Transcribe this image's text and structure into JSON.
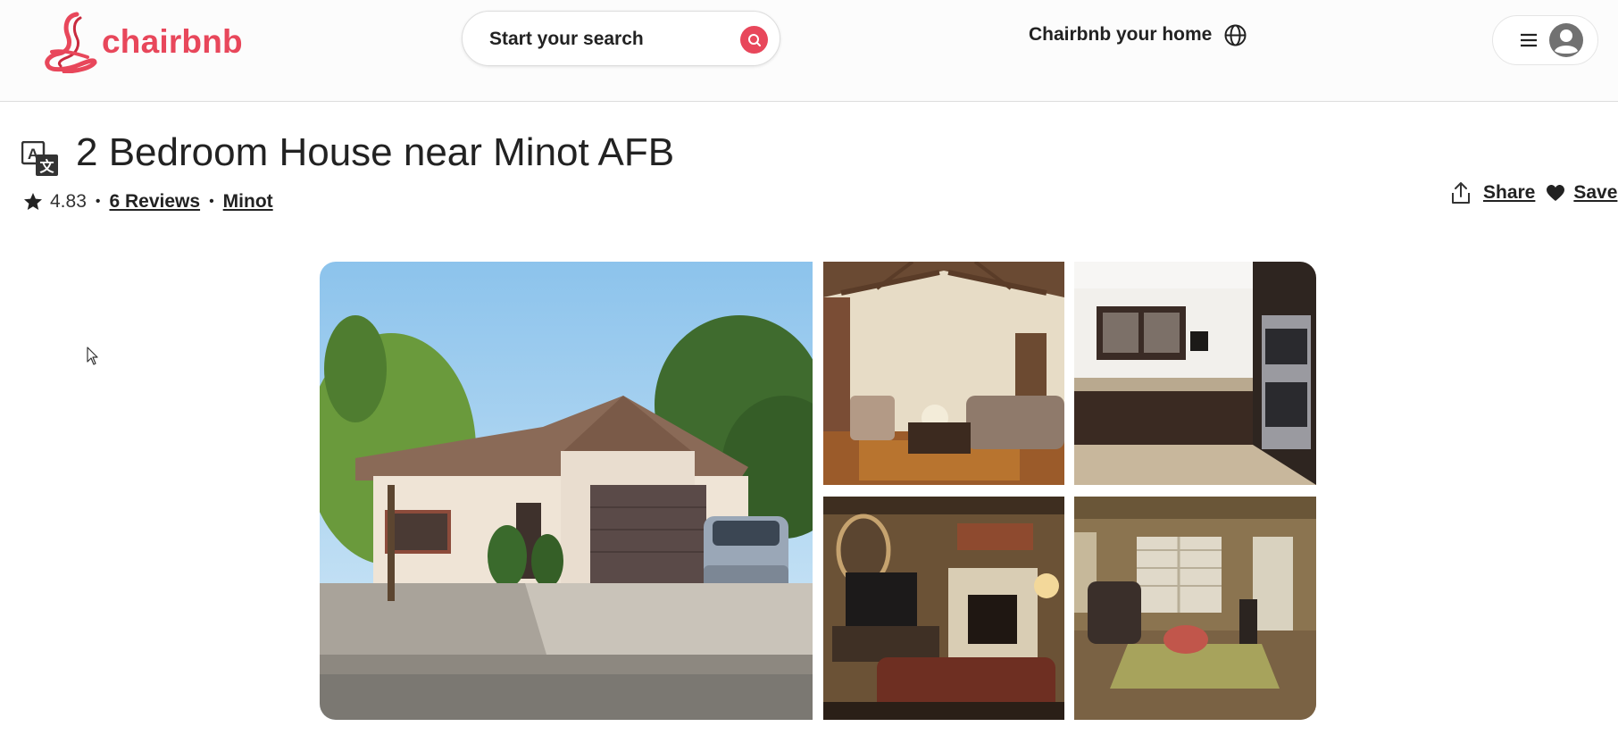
{
  "brand": {
    "name": "chairbnb",
    "accent_color": "#e8475b"
  },
  "header": {
    "search_label": "Start your search",
    "host_link": "Chairbnb your home",
    "icons": [
      "search-icon",
      "globe-icon",
      "hamburger-menu-icon",
      "user-avatar-icon"
    ]
  },
  "listing": {
    "title": "2 Bedroom House near Minot AFB",
    "rating": "4.83",
    "reviews_link": "6 Reviews",
    "location_link": "Minot",
    "share_label": "Share",
    "save_label": "Save"
  },
  "gallery": {
    "photos": [
      "house-exterior-photo",
      "living-room-photo",
      "kitchen-photo",
      "family-room-fireplace-photo",
      "den-photo"
    ]
  }
}
